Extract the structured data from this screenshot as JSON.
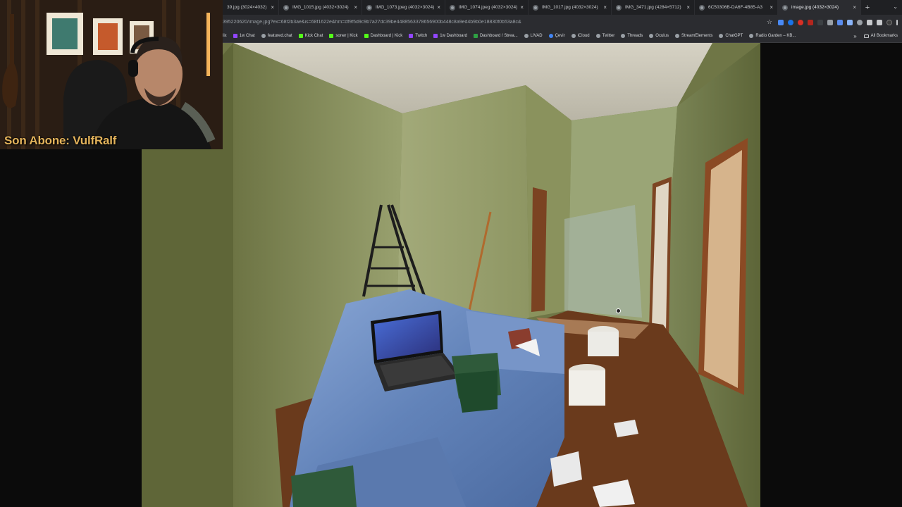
{
  "browser": {
    "tabs": [
      {
        "label": "39.jpg (3024×4032)",
        "active": false
      },
      {
        "label": "IMG_1015.jpg (4032×3024)",
        "active": false
      },
      {
        "label": "IMG_1073.jpeg (4032×3024)",
        "active": false
      },
      {
        "label": "IMG_1074.jpeg (4032×3024)",
        "active": false
      },
      {
        "label": "IMG_1017.jpg (4032×3024)",
        "active": false
      },
      {
        "label": "IMG_3471.jpg (4284×5712)",
        "active": false
      },
      {
        "label": "6C50306B-DA6F-4B85-A3",
        "active": false
      },
      {
        "label": "image.jpg (4032×3024)",
        "active": true
      }
    ],
    "url": "395220620/image.jpg?ex=68f2b3ae&is=68f1622e&hm=df9f5d9c9b7a27dc39be4488563378656900b448c8a9ed4b9b0e18830f0b53a8c&",
    "bookmarks": [
      {
        "label": "lix",
        "icon": "site"
      },
      {
        "label": "1w Chat",
        "icon": "twitch"
      },
      {
        "label": "featured.chat",
        "icon": "site"
      },
      {
        "label": "Kick Chat",
        "icon": "kick"
      },
      {
        "label": "soner | Kick",
        "icon": "kick"
      },
      {
        "label": "Dashboard | Kick",
        "icon": "kick"
      },
      {
        "label": "Twitch",
        "icon": "twitch"
      },
      {
        "label": "1w Dashboard",
        "icon": "twitch"
      },
      {
        "label": "Dashboard / Strea...",
        "icon": "green"
      },
      {
        "label": "LIVAD",
        "icon": "site"
      },
      {
        "label": "Çevir",
        "icon": "site"
      },
      {
        "label": "iCloud",
        "icon": "site"
      },
      {
        "label": "Twitter",
        "icon": "site"
      },
      {
        "label": "Threads",
        "icon": "site"
      },
      {
        "label": "Oculus",
        "icon": "site"
      },
      {
        "label": "StreamElements",
        "icon": "site"
      },
      {
        "label": "ChatGPT",
        "icon": "site"
      },
      {
        "label": "Radio Garden – KB...",
        "icon": "site"
      }
    ],
    "more_bookmarks": "»",
    "all_bookmarks": "All Bookmarks",
    "new_tab": "+",
    "close_glyph": "×",
    "star_glyph": "☆",
    "expand_glyph": "⌄"
  },
  "overlay": {
    "streamer_text": "Son Abone: VulfRalf"
  },
  "colors": {
    "wall": "#8b9563",
    "ceiling": "#c9c6b8",
    "floor": "#6a3a1c",
    "plastic": "#6b8fc4",
    "overlay_text": "#e3b35b"
  },
  "icons": [
    "favicon-icon",
    "close-icon",
    "new-tab-icon",
    "star-icon",
    "extension-icon",
    "bookmark-icon",
    "folder-icon",
    "zoom-cursor-icon"
  ]
}
